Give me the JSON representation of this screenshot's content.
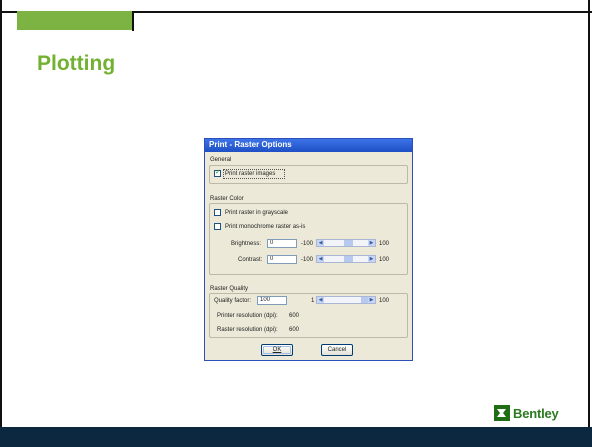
{
  "slide": {
    "title": "Plotting",
    "logo_text": "Bentley",
    "colors": {
      "title": "#73b132",
      "accent_tab": "#7cb342",
      "footer_bar": "#0c2740",
      "logo": "#2a7a1e"
    }
  },
  "dialog": {
    "title": "Print - Raster Options",
    "general": {
      "legend": "General",
      "print_raster_images": {
        "label": "Print raster images",
        "checked": true
      }
    },
    "raster_color": {
      "legend": "Raster Color",
      "grayscale": {
        "label": "Print raster in grayscale",
        "checked": false
      },
      "monochrome": {
        "label": "Print monochrome raster as-is",
        "checked": false
      },
      "brightness": {
        "label": "Brightness:",
        "value": "0",
        "min": "-100",
        "max": "100"
      },
      "contrast": {
        "label": "Contrast:",
        "value": "0",
        "min": "-100",
        "max": "100"
      }
    },
    "raster_quality": {
      "legend": "Raster Quality",
      "quality_factor": {
        "label": "Quality factor:",
        "value": "100",
        "min": "1",
        "max": "100"
      },
      "printer_resolution": {
        "label": "Printer resolution (dpi):",
        "value": "600"
      },
      "raster_resolution": {
        "label": "Raster resolution (dpi):",
        "value": "600"
      }
    },
    "buttons": {
      "ok": "OK",
      "cancel": "Cancel"
    },
    "colors": {
      "titlebar": "#1e4fc4",
      "face": "#ece9d8",
      "check": "#21a121"
    }
  }
}
